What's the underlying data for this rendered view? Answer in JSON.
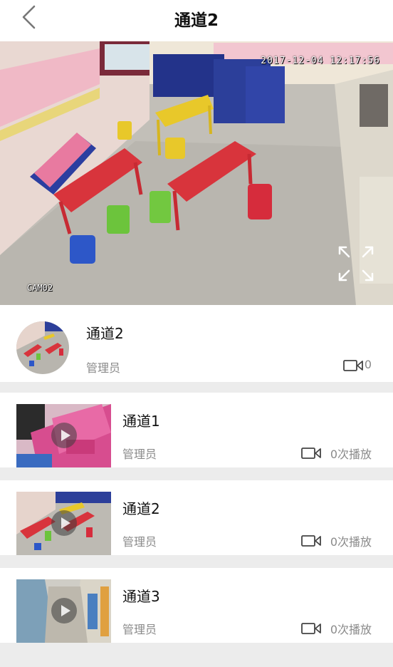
{
  "header": {
    "title": "通道2"
  },
  "video": {
    "timestamp": "2017-12-04 12:17:56",
    "camera_label": "CAM02"
  },
  "current_channel": {
    "name": "通道2",
    "owner": "管理员",
    "play_count": "0"
  },
  "channels": [
    {
      "name": "通道1",
      "owner": "管理员",
      "plays": "0次播放"
    },
    {
      "name": "通道2",
      "owner": "管理员",
      "plays": "0次播放"
    },
    {
      "name": "通道3",
      "owner": "管理员",
      "plays": "0次播放"
    }
  ],
  "icons": {
    "back": "chevron-left-icon",
    "fullscreen": "fullscreen-icon",
    "camera": "video-camera-icon",
    "play": "play-icon"
  },
  "colors": {
    "background": "#ececec",
    "card": "#ffffff",
    "muted_text": "#8a8a8a"
  }
}
